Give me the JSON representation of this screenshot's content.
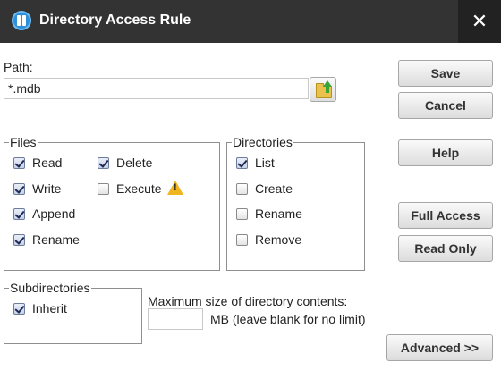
{
  "window": {
    "title": "Directory Access Rule",
    "close_glyph": "✕",
    "app_icon": "app-logo-icon"
  },
  "path": {
    "label": "Path:",
    "value": "*.mdb",
    "browse_icon": "folder-up-icon"
  },
  "buttons": {
    "save": "Save",
    "cancel": "Cancel",
    "help": "Help",
    "full_access": "Full Access",
    "read_only": "Read Only",
    "advanced": "Advanced >>"
  },
  "files": {
    "legend": "Files",
    "read": "Read",
    "write": "Write",
    "append": "Append",
    "rename": "Rename",
    "delete": "Delete",
    "execute": "Execute",
    "checked": {
      "read": true,
      "write": true,
      "append": true,
      "rename": true,
      "delete": true,
      "execute": false
    },
    "execute_warning_icon": "warning-icon"
  },
  "directories": {
    "legend": "Directories",
    "list": "List",
    "create": "Create",
    "rename": "Rename",
    "remove": "Remove",
    "checked": {
      "list": true,
      "create": false,
      "rename": false,
      "remove": false
    }
  },
  "subdirectories": {
    "legend": "Subdirectories",
    "inherit": "Inherit",
    "checked": {
      "inherit": true
    }
  },
  "max_size": {
    "label": "Maximum size of directory contents:",
    "value": "",
    "unit_label": "MB (leave blank for no limit)"
  },
  "colors": {
    "titlebar": "#333333",
    "close_bg": "#222222",
    "app_icon": "#2f8fd8",
    "warning": "#f0b41d"
  }
}
